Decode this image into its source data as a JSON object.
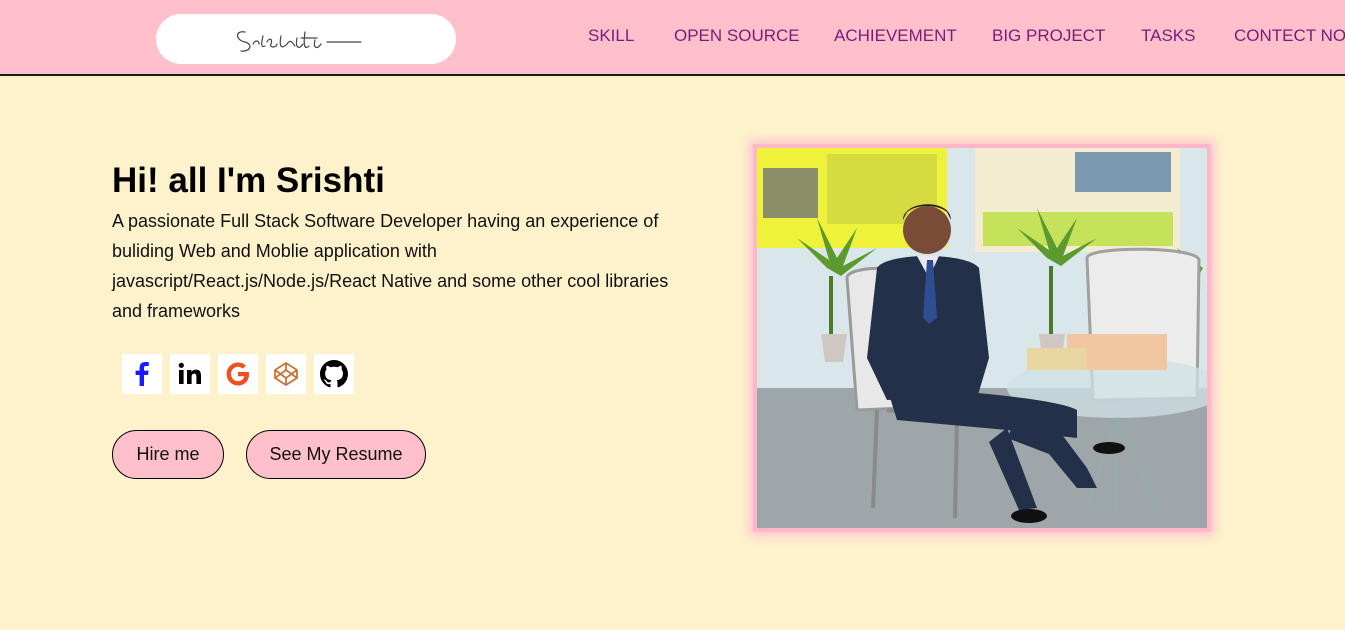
{
  "header": {
    "logo_text": "Srishti",
    "nav": [
      {
        "label": "SKILL"
      },
      {
        "label": "OPEN SOURCE"
      },
      {
        "label": "ACHIEVEMENT"
      },
      {
        "label": "BIG PROJECT"
      },
      {
        "label": "TASKS"
      },
      {
        "label": "CONTECT NO"
      }
    ]
  },
  "hero": {
    "title": "Hi! all I'm Srishti",
    "description": "A passionate Full Stack Software Developer having an experience of buliding Web and Moblie application with javascript/React.js/Node.js/React Native and some other cool libraries and frameworks",
    "socials": [
      {
        "icon": "facebook-icon",
        "glyph": "f",
        "color": "#1a1aff"
      },
      {
        "icon": "linkedin-icon",
        "glyph": "in",
        "color": "#000000"
      },
      {
        "icon": "google-icon",
        "glyph": "G",
        "color": "#ea4335"
      },
      {
        "icon": "codepen-icon",
        "glyph": "",
        "color": "#c8733a"
      },
      {
        "icon": "github-icon",
        "glyph": "",
        "color": "#000000"
      }
    ],
    "hire_label": "Hire me",
    "resume_label": "See My Resume"
  },
  "colors": {
    "header_bg": "#ffc0cb",
    "page_bg": "#fdf2cb",
    "nav_text": "#7b1a7b",
    "button_bg": "#ffc0cb"
  }
}
